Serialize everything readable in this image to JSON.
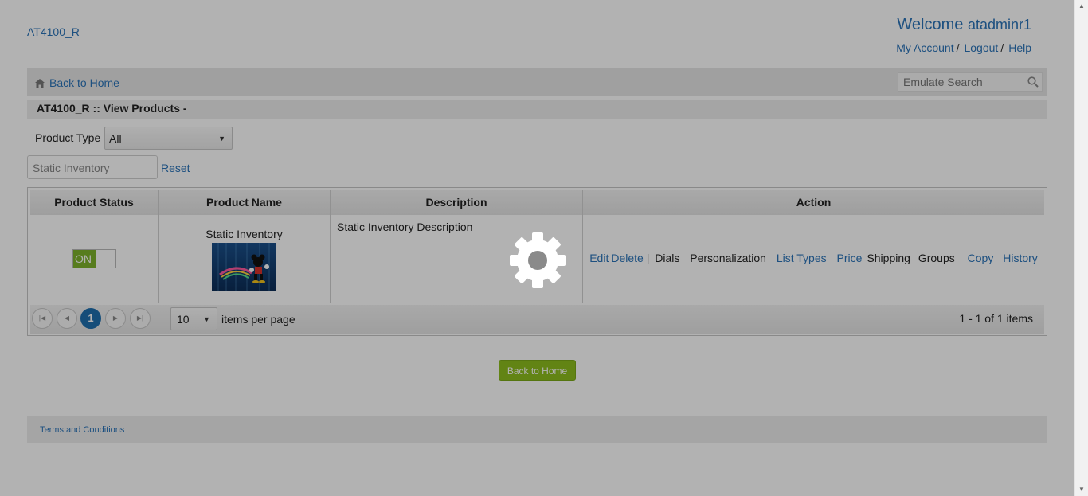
{
  "header": {
    "brand": "AT4100_R",
    "welcome_label": "Welcome",
    "username": "atadminr1",
    "links": {
      "my_account": "My Account",
      "logout": "Logout",
      "help": "Help",
      "separator": "/"
    }
  },
  "nav": {
    "back_home": "Back to Home",
    "emulate_placeholder": "Emulate Search"
  },
  "page_title": "AT4100_R :: View Products -",
  "filters": {
    "product_type_label": "Product Type :",
    "product_type_value": "All",
    "search_value": "Static Inventory",
    "reset": "Reset"
  },
  "grid": {
    "columns": [
      "Product Status",
      "Product Name",
      "Description",
      "Action"
    ],
    "rows": [
      {
        "status": "ON",
        "name": "Static Inventory",
        "description": "Static Inventory Description",
        "actions": {
          "edit": "Edit",
          "delete": "Delete",
          "pipe": "|",
          "dials": "Dials",
          "personalization": "Personalization",
          "list_types": "List Types",
          "price": "Price",
          "shipping": "Shipping",
          "groups": "Groups",
          "copy": "Copy",
          "history": "History"
        }
      }
    ],
    "pager": {
      "current_page": "1",
      "page_size": "10",
      "items_per_page": "items per page",
      "count": "1 - 1 of 1 items"
    }
  },
  "back_button": "Back to Home",
  "footer": {
    "terms": "Terms and Conditions"
  },
  "colors": {
    "link": "#2a73b8",
    "toggle_on": "#7db22b",
    "primary_button": "#8dbd1e",
    "pager_current": "#1f6fae"
  },
  "icons": [
    "home-icon",
    "search-icon",
    "gear-icon",
    "first-page-icon",
    "prev-page-icon",
    "next-page-icon",
    "last-page-icon"
  ]
}
